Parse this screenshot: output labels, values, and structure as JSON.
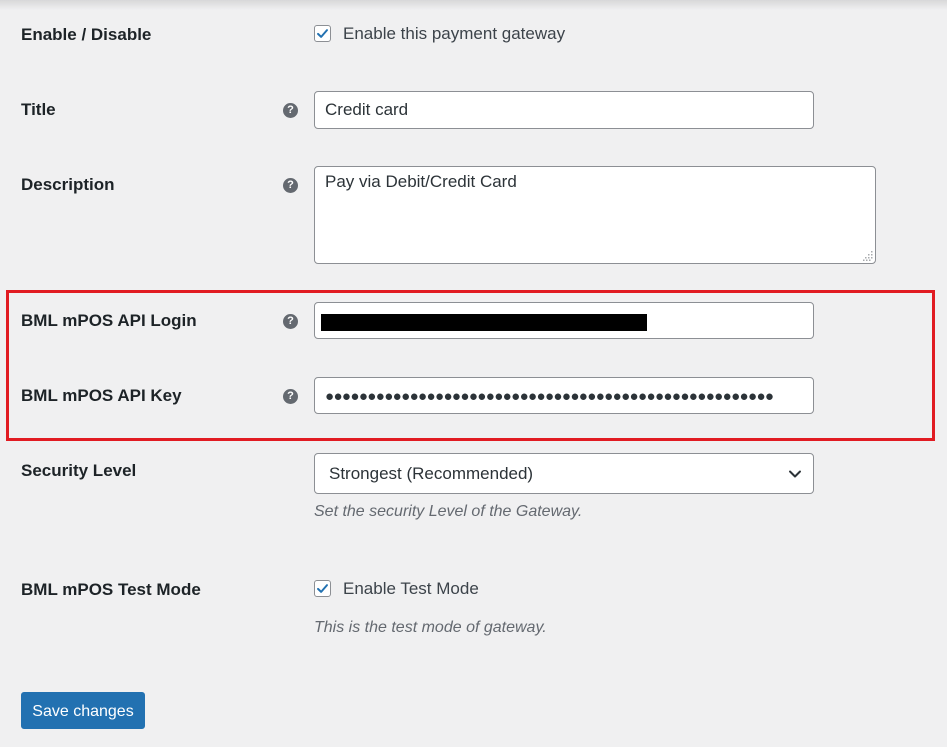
{
  "form": {
    "enable": {
      "label": "Enable / Disable",
      "checkbox_label": "Enable this payment gateway",
      "checked": true
    },
    "title": {
      "label": "Title",
      "help_icon": "question-circle-icon",
      "value": "Credit card"
    },
    "description": {
      "label": "Description",
      "help_icon": "question-circle-icon",
      "value": "Pay via Debit/Credit Card"
    },
    "api_login": {
      "label": "BML mPOS API Login",
      "help_icon": "question-circle-icon",
      "value_state": "redacted"
    },
    "api_key": {
      "label": "BML mPOS API Key",
      "help_icon": "question-circle-icon",
      "masked_value": "●●●●●●●●●●●●●●●●●●●●●●●●●●●●●●●●●●●●●●●●●●●●●●●●●●●●●"
    },
    "security_level": {
      "label": "Security Level",
      "selected": "Strongest (Recommended)",
      "description": "Set the security Level of the Gateway."
    },
    "test_mode": {
      "label": "BML mPOS Test Mode",
      "checkbox_label": "Enable Test Mode",
      "checked": true,
      "description": "This is the test mode of gateway."
    },
    "save_label": "Save changes"
  },
  "colors": {
    "background": "#f0f0f1",
    "primary": "#2271b1",
    "highlight": "#e11b22",
    "help_icon": "#646970"
  }
}
